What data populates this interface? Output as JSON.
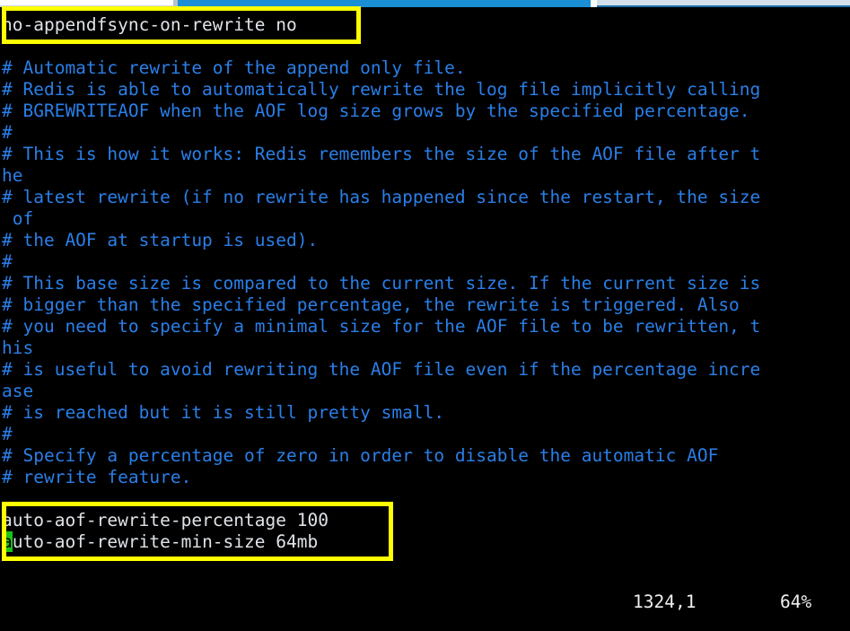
{
  "window": {
    "kind": "terminal-vim-editor",
    "background_color": "#000000",
    "chrome": {
      "tab_inactive_color": "#ffffff",
      "tab_active_color": "#1a8fd4",
      "toolbar_color": "#d3e0ea"
    }
  },
  "colors": {
    "comment": "#2a7fe8",
    "config_text": "#dfe3e8",
    "cursor_block": "#19c419",
    "annotation_box": "#ffff00",
    "status_text": "#f0f0f0"
  },
  "editor": {
    "lines": [
      {
        "id": "l01",
        "kind": "config",
        "text": "no-appendfsync-on-rewrite no"
      },
      {
        "id": "l02",
        "kind": "blank",
        "text": ""
      },
      {
        "id": "l03",
        "kind": "comment",
        "text": "# Automatic rewrite of the append only file."
      },
      {
        "id": "l04",
        "kind": "comment",
        "text": "# Redis is able to automatically rewrite the log file implicitly calling"
      },
      {
        "id": "l05",
        "kind": "comment",
        "text": "# BGREWRITEAOF when the AOF log size grows by the specified percentage."
      },
      {
        "id": "l06",
        "kind": "comment",
        "text": "#"
      },
      {
        "id": "l07",
        "kind": "comment",
        "text": "# This is how it works: Redis remembers the size of the AOF file after t"
      },
      {
        "id": "l08",
        "kind": "comment",
        "text": "he"
      },
      {
        "id": "l09",
        "kind": "comment",
        "text": "# latest rewrite (if no rewrite has happened since the restart, the size"
      },
      {
        "id": "l10",
        "kind": "comment",
        "text": " of"
      },
      {
        "id": "l11",
        "kind": "comment",
        "text": "# the AOF at startup is used)."
      },
      {
        "id": "l12",
        "kind": "comment",
        "text": "#"
      },
      {
        "id": "l13",
        "kind": "comment",
        "text": "# This base size is compared to the current size. If the current size is"
      },
      {
        "id": "l14",
        "kind": "comment",
        "text": "# bigger than the specified percentage, the rewrite is triggered. Also"
      },
      {
        "id": "l15",
        "kind": "comment",
        "text": "# you need to specify a minimal size for the AOF file to be rewritten, t"
      },
      {
        "id": "l16",
        "kind": "comment",
        "text": "his"
      },
      {
        "id": "l17",
        "kind": "comment",
        "text": "# is useful to avoid rewriting the AOF file even if the percentage incre"
      },
      {
        "id": "l18",
        "kind": "comment",
        "text": "ase"
      },
      {
        "id": "l19",
        "kind": "comment",
        "text": "# is reached but it is still pretty small."
      },
      {
        "id": "l20",
        "kind": "comment",
        "text": "#"
      },
      {
        "id": "l21",
        "kind": "comment",
        "text": "# Specify a percentage of zero in order to disable the automatic AOF"
      },
      {
        "id": "l22",
        "kind": "comment",
        "text": "# rewrite feature."
      },
      {
        "id": "l23",
        "kind": "blank",
        "text": ""
      },
      {
        "id": "l24",
        "kind": "config",
        "text": "auto-aof-rewrite-percentage 100"
      },
      {
        "id": "l25",
        "kind": "config",
        "text": "auto-aof-rewrite-min-size 64mb",
        "cursor_index": 0
      }
    ]
  },
  "annotations": [
    {
      "id": "a1",
      "target_line": "l01",
      "label": "no-appendfsync-on-rewrite-highlight"
    },
    {
      "id": "a2",
      "target_line": "l24",
      "label": "auto-aof-rewrite-settings-highlight"
    }
  ],
  "status_bar": {
    "ruler_position": "1324,1",
    "scroll_percent": "64%"
  }
}
